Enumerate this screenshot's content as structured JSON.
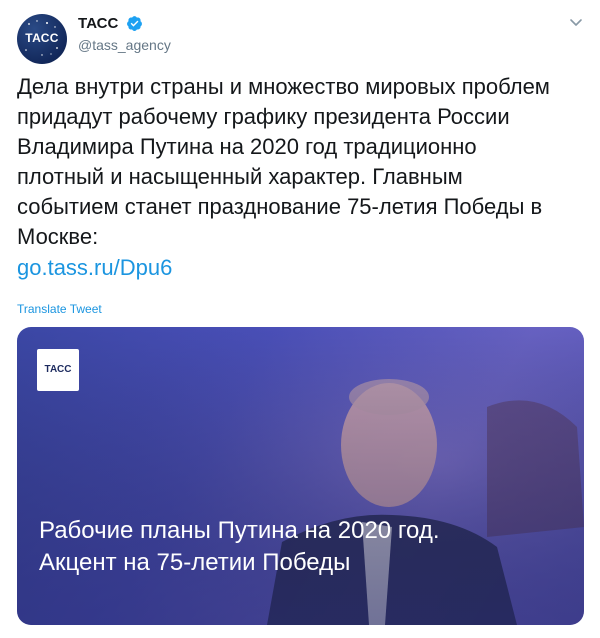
{
  "author": {
    "display_name": "ТАСС",
    "handle": "@tass_agency",
    "avatar_text": "ТАСС",
    "verified": true
  },
  "tweet": {
    "text": "Дела внутри страны и множество мировых проблем\nпридадут рабочему графику президента России\nВладимира Путина на 2020 год традиционно\nплотный и насыщенный характер. Главным\nсобытием станет празднование 75-летия Победы в\nМоскве:",
    "link": "go.tass.ru/Dpu6",
    "translate_label": "Translate Tweet"
  },
  "card": {
    "logo_text": "ТАСС",
    "headline": "Рабочие планы Путина на 2020 год.\nАкцент на 75-летии Победы"
  },
  "colors": {
    "link": "#1b95e0",
    "text": "#14171a",
    "secondary": "#657786",
    "card_bg": "#4a4fb8"
  },
  "icons": {
    "verified": "verified-badge-icon",
    "more": "chevron-down-icon"
  }
}
